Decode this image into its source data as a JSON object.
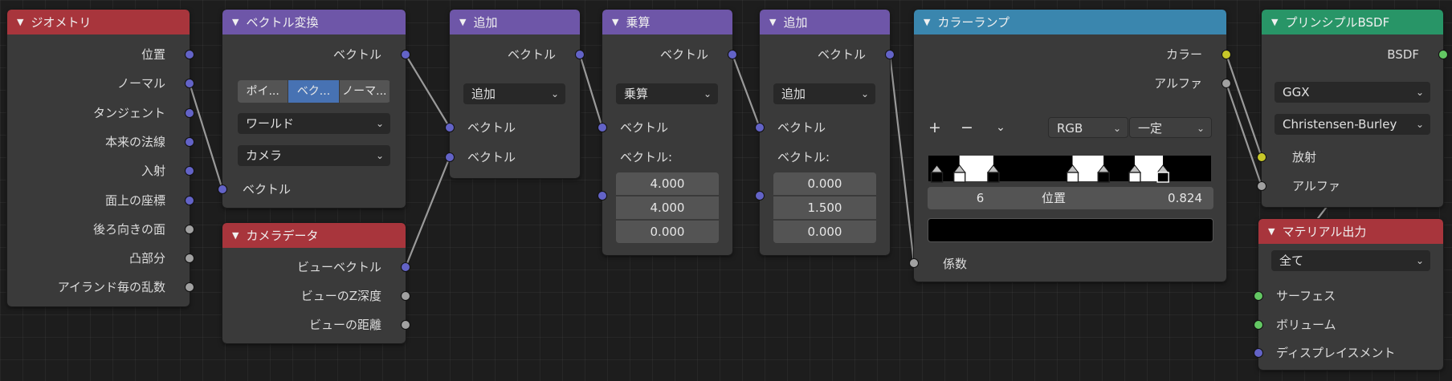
{
  "colors": {
    "background": "#1d1d1d",
    "node_body": "#3a3a3a",
    "header_input": "#a8353c",
    "header_vector": "#6e56a8",
    "header_converter": "#3a86ae",
    "header_shader": "#289567",
    "socket_vector": "#6363c7",
    "socket_float": "#a1a1a1",
    "socket_color": "#c7c729",
    "socket_shader": "#63c763"
  },
  "nodes": {
    "geometry": {
      "title": "ジオメトリ",
      "outputs": [
        "位置",
        "ノーマル",
        "タンジェント",
        "本来の法線",
        "入射",
        "面上の座標",
        "後ろ向きの面",
        "凸部分",
        "アイランド毎の乱数"
      ]
    },
    "vector_transform": {
      "title": "ベクトル変換",
      "output": "ベクトル",
      "type_options": [
        "ポイ...",
        "ベク...",
        "ノーマ..."
      ],
      "type_selected": 1,
      "from": "ワールド",
      "to": "カメラ",
      "input": "ベクトル"
    },
    "camera_data": {
      "title": "カメラデータ",
      "outputs": [
        "ビューベクトル",
        "ビューのZ深度",
        "ビューの距離"
      ]
    },
    "add1": {
      "title": "追加",
      "output": "ベクトル",
      "operation": "追加",
      "inputs": [
        "ベクトル",
        "ベクトル"
      ]
    },
    "multiply": {
      "title": "乗算",
      "output": "ベクトル",
      "operation": "乗算",
      "input": "ベクトル",
      "vector_label": "ベクトル:",
      "values": [
        "4.000",
        "4.000",
        "0.000"
      ]
    },
    "add2": {
      "title": "追加",
      "output": "ベクトル",
      "operation": "追加",
      "input": "ベクトル",
      "vector_label": "ベクトル:",
      "values": [
        "0.000",
        "1.500",
        "0.000"
      ]
    },
    "color_ramp": {
      "title": "カラーランプ",
      "outputs": [
        "カラー",
        "アルファ"
      ],
      "add_symbol": "+",
      "remove_symbol": "−",
      "mode": "RGB",
      "interpolation": "一定",
      "stop_index": "6",
      "position_label": "位置",
      "position_value": "0.824",
      "input": "係数",
      "active_stop_color": "#000000",
      "stops": [
        {
          "pos": 0.03,
          "color": "black"
        },
        {
          "pos": 0.11,
          "color": "white"
        },
        {
          "pos": 0.23,
          "color": "black"
        },
        {
          "pos": 0.51,
          "color": "white"
        },
        {
          "pos": 0.62,
          "color": "black"
        },
        {
          "pos": 0.73,
          "color": "white"
        },
        {
          "pos": 0.83,
          "color": "black"
        }
      ]
    },
    "principled": {
      "title": "プリンシプルBSDF",
      "output": "BSDF",
      "distribution": "GGX",
      "subsurface": "Christensen-Burley",
      "inputs": [
        "放射",
        "アルファ"
      ]
    },
    "material_output": {
      "title": "マテリアル出力",
      "target": "全て",
      "inputs": [
        "サーフェス",
        "ボリューム",
        "ディスプレイスメント"
      ]
    }
  }
}
